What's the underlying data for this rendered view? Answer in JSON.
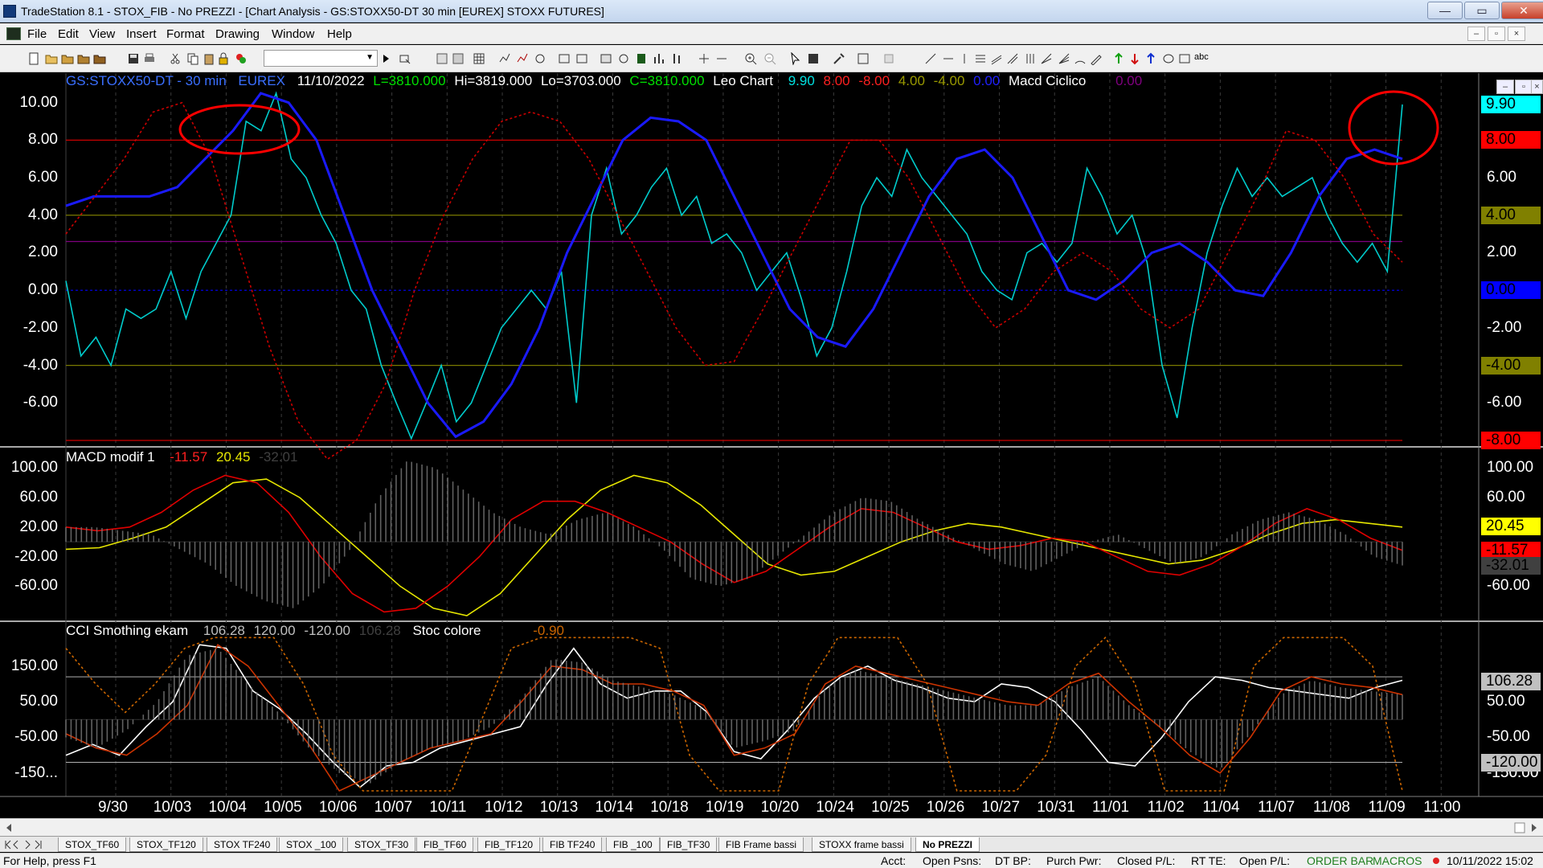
{
  "window": {
    "title": "TradeStation 8.1 - STOX_FIB - No PREZZI - [Chart Analysis - GS:STOXX50-DT  30 min  [EUREX] STOXX FUTURES]",
    "minimize": "—",
    "maximize": "▭",
    "close": "✕"
  },
  "menu": {
    "items": [
      "File",
      "Edit",
      "View",
      "Insert",
      "Format",
      "Drawing",
      "Window",
      "Help"
    ],
    "mdi_min": "–",
    "mdi_restore": "▫",
    "mdi_close": "×"
  },
  "toolbar": {
    "combo_arrow": "▼",
    "text_tool": "abc"
  },
  "chart_data": [
    {
      "type": "line",
      "header": {
        "symbol": "GS:STOXX50-DT - 30 min",
        "exchange": "EUREX",
        "date": "11/10/2022",
        "last": "L=3810.000",
        "high": "Hi=3819.000",
        "low": "Lo=3703.000",
        "close": "C=3810.000",
        "indicator": "Leo Chart",
        "v1": "9.90",
        "v2": "8.00",
        "v3": "-8.00",
        "v4": "4.00",
        "v5": "-4.00",
        "v6": "0.00",
        "indicator2": "Macd Ciclico",
        "v7": "0.00"
      },
      "y_ticks": [
        "10.00",
        "8.00",
        "6.00",
        "4.00",
        "2.00",
        "0.00",
        "-2.00",
        "-4.00",
        "-6.00"
      ],
      "right_ticks": [
        "6.00",
        "2.00",
        "-2.00",
        "-6.00"
      ],
      "ylim": [
        -8,
        10.5
      ],
      "levels": [
        {
          "value": 8,
          "color": "#cc0000"
        },
        {
          "value": -8,
          "color": "#cc0000"
        },
        {
          "value": 4,
          "color": "#7a7a00"
        },
        {
          "value": -4,
          "color": "#7a7a00"
        },
        {
          "value": 2.6,
          "color": "#800080"
        },
        {
          "value": 0,
          "color": "#0000ff"
        }
      ],
      "tags": [
        {
          "label": "9.90",
          "bg": "#00ffff",
          "fg": "#000000"
        },
        {
          "label": "8.00",
          "bg": "#ff0000",
          "fg": "#000000"
        },
        {
          "label": "4.00",
          "bg": "#808000",
          "fg": "#000000"
        },
        {
          "label": "0.00",
          "bg": "#0000ff",
          "fg": "#000000"
        },
        {
          "label": "-4.00",
          "bg": "#808000",
          "fg": "#000000"
        },
        {
          "label": "-8.00",
          "bg": "#ff0000",
          "fg": "#000000"
        }
      ],
      "series": [
        {
          "color": "#00cccc",
          "values": [
            0.5,
            -3.5,
            -2.5,
            -4,
            -1,
            -1.5,
            -1,
            1,
            -1.5,
            1,
            2.5,
            4,
            9,
            8.5,
            10.5,
            7,
            6,
            4,
            2.5,
            0,
            -1,
            -4,
            -6,
            -7.9,
            -6,
            -4,
            -7,
            -6,
            -4,
            -2,
            -1,
            0,
            -1,
            1,
            -6,
            4,
            6.5,
            3,
            4,
            5.5,
            6.5,
            4,
            5,
            2.5,
            3,
            2,
            0,
            1,
            2,
            -0.5,
            -3.5,
            -2,
            1,
            4.5,
            6,
            5,
            7.5,
            6,
            5,
            4,
            3,
            1,
            0,
            -0.5,
            2,
            2.5,
            1.5,
            2.5,
            6.5,
            5,
            3,
            4,
            1.5,
            -4,
            -6.8,
            -2,
            2,
            4.5,
            6.5,
            5,
            6,
            5,
            5.5,
            6,
            4,
            2.5,
            1.5,
            2.5,
            1,
            9.9
          ]
        },
        {
          "color": "#1a1aff",
          "values": [
            4.5,
            5,
            5,
            5,
            5.5,
            7,
            8.5,
            10.5,
            10,
            8,
            4,
            0,
            -3,
            -6,
            -7.8,
            -7,
            -5,
            -2,
            2,
            5,
            8,
            9.2,
            9,
            8,
            5,
            2,
            -1,
            -2.5,
            -3,
            -1,
            2,
            5,
            7,
            7.5,
            6,
            3,
            0,
            -0.5,
            0.5,
            2,
            2.5,
            1.5,
            0,
            -0.3,
            2,
            5,
            7,
            7.5,
            7
          ]
        },
        {
          "color": "#cc0000",
          "dashed": true,
          "values": [
            3,
            5,
            7,
            9.5,
            10,
            7,
            2,
            -3,
            -7,
            -9,
            -8,
            -5,
            0,
            4,
            7,
            9,
            9.5,
            9,
            7,
            4,
            1,
            -2,
            -4,
            -3.8,
            -1,
            2,
            5,
            8,
            8,
            6,
            3,
            0,
            -2,
            -1,
            1,
            2,
            1,
            -1,
            -2,
            -1,
            2,
            5,
            8.5,
            8,
            6,
            3,
            1.5
          ]
        }
      ]
    },
    {
      "type": "line",
      "title": "MACD modif 1",
      "values_shown": [
        "-11.57",
        "20.45",
        "-32.01"
      ],
      "y_ticks": [
        "100.00",
        "60.00",
        "20.00",
        "-20.00",
        "-60.00"
      ],
      "right_ticks": [
        "100.00",
        "60.00",
        "-60.00"
      ],
      "ylim": [
        -100,
        120
      ],
      "tags": [
        {
          "label": "20.45",
          "bg": "#ffff00",
          "fg": "#000000"
        },
        {
          "label": "-11.57",
          "bg": "#ff0000",
          "fg": "#000000"
        },
        {
          "label": "-32.01",
          "bg": "#404040",
          "fg": "#000000"
        }
      ],
      "series": [
        {
          "color": "#e6e600",
          "values": [
            -10,
            -8,
            5,
            20,
            50,
            80,
            85,
            60,
            20,
            -20,
            -60,
            -90,
            -100,
            -70,
            -20,
            30,
            70,
            90,
            80,
            50,
            10,
            -30,
            -45,
            -40,
            -20,
            0,
            15,
            25,
            20,
            10,
            0,
            -10,
            -20,
            -30,
            -25,
            -10,
            10,
            25,
            30,
            25,
            20
          ]
        },
        {
          "color": "#e00000",
          "values": [
            20,
            15,
            20,
            40,
            70,
            90,
            80,
            40,
            -20,
            -70,
            -95,
            -90,
            -60,
            -20,
            30,
            55,
            55,
            40,
            20,
            0,
            -30,
            -55,
            -40,
            -10,
            20,
            45,
            40,
            20,
            0,
            -10,
            -5,
            5,
            0,
            -20,
            -40,
            -45,
            -30,
            -5,
            25,
            45,
            30,
            5,
            -11.57
          ]
        },
        {
          "color": "#7a7a7a",
          "bar": true,
          "values": [
            20,
            20,
            15,
            10,
            -10,
            -30,
            -60,
            -80,
            -90,
            -60,
            -10,
            60,
            110,
            100,
            70,
            40,
            20,
            10,
            30,
            40,
            20,
            -10,
            -50,
            -60,
            -50,
            -20,
            10,
            40,
            60,
            55,
            30,
            10,
            -10,
            -30,
            -40,
            -20,
            0,
            10,
            -10,
            -30,
            -20,
            10,
            30,
            40,
            30,
            10,
            -20,
            -32
          ]
        }
      ]
    },
    {
      "type": "line",
      "title": "CCI Smothing ekam",
      "values_shown": [
        "106.28",
        "120.00",
        "-120.00",
        "106.28"
      ],
      "stoc_title": "Stoc colore",
      "stoc_value": "-0.90",
      "y_ticks": [
        "150.00",
        "50.00",
        "-50.00",
        "-150..."
      ],
      "right_ticks": [
        "-150.00",
        "50.00",
        "-50.00",
        "-150.00"
      ],
      "ylim": [
        -200,
        260
      ],
      "tags": [
        {
          "label": "106.28",
          "bg": "#c0c0c0",
          "fg": "#000000"
        },
        {
          "label": "-120.00",
          "bg": "#c0c0c0",
          "fg": "#000000"
        }
      ],
      "series": [
        {
          "color": "#ffffff",
          "values": [
            -100,
            -70,
            -100,
            -20,
            50,
            210,
            200,
            80,
            30,
            -40,
            -120,
            -190,
            -130,
            -120,
            -80,
            -60,
            -40,
            -20,
            100,
            200,
            100,
            60,
            80,
            80,
            20,
            -90,
            -110,
            -30,
            60,
            120,
            150,
            110,
            90,
            60,
            50,
            100,
            90,
            50,
            -30,
            -120,
            -130,
            -50,
            50,
            120,
            110,
            90,
            80,
            70,
            60,
            90,
            110
          ]
        },
        {
          "color": "#cc3300",
          "values": [
            -40,
            -80,
            -100,
            -40,
            40,
            210,
            150,
            40,
            -70,
            -200,
            -160,
            -120,
            -80,
            -60,
            -40,
            50,
            150,
            140,
            100,
            100,
            80,
            40,
            -100,
            -80,
            -40,
            100,
            150,
            130,
            110,
            90,
            70,
            50,
            40,
            100,
            130,
            50,
            -20,
            -100,
            -150,
            -50,
            80,
            120,
            100,
            90,
            70
          ]
        },
        {
          "color": "#cc6600",
          "dashed": true,
          "values": [
            200,
            100,
            20,
            100,
            200,
            230,
            230,
            230,
            100,
            -100,
            -200,
            -200,
            -200,
            -200,
            0,
            200,
            230,
            230,
            230,
            230,
            200,
            -100,
            -200,
            -200,
            -200,
            100,
            230,
            230,
            230,
            100,
            -200,
            -200,
            -200,
            -100,
            150,
            230,
            100,
            -200,
            -200,
            -200,
            150,
            230,
            230,
            230,
            150,
            -200
          ]
        },
        {
          "color": "#7a7a7a",
          "bar": true,
          "values": [
            -50,
            -80,
            -30,
            50,
            180,
            200,
            100,
            20,
            -80,
            -150,
            -180,
            -120,
            -80,
            -60,
            -20,
            60,
            170,
            160,
            110,
            90,
            70,
            30,
            -80,
            -60,
            -30,
            90,
            140,
            120,
            100,
            80,
            60,
            40,
            40,
            90,
            120,
            40,
            -20,
            -90,
            -140,
            -40,
            70,
            110,
            90,
            80,
            70
          ]
        }
      ]
    }
  ],
  "dates": [
    "9/30",
    "10/03",
    "10/04",
    "10/05",
    "10/06",
    "10/07",
    "10/11",
    "10/12",
    "10/13",
    "10/14",
    "10/18",
    "10/19",
    "10/20",
    "10/24",
    "10/25",
    "10/26",
    "10/27",
    "10/31",
    "11/01",
    "11/02",
    "11/04",
    "11/07",
    "11/08",
    "11/09",
    "11:00"
  ],
  "tabs": [
    "STOX_TF60",
    "STOX_TF120",
    "STOX TF240",
    "STOX _100",
    "STOX_TF30",
    "FIB_TF60",
    "FIB_TF120",
    "FIB TF240",
    "FIB _100",
    "FIB_TF30",
    "FIB Frame bassi",
    "STOXX frame bassi",
    "No PREZZI"
  ],
  "status": {
    "help": "For Help, press F1",
    "acct": "Acct:",
    "open_psns": "Open Psns:",
    "dt_bp": "DT BP:",
    "purch_pwr": "Purch Pwr:",
    "closed_pl": "Closed P/L:",
    "rt_te": "RT TE:",
    "open_pl": "Open P/L:",
    "order_bar": "ORDER BAR",
    "macros": "MACROS",
    "datetime": "10/11/2022 15:02"
  }
}
